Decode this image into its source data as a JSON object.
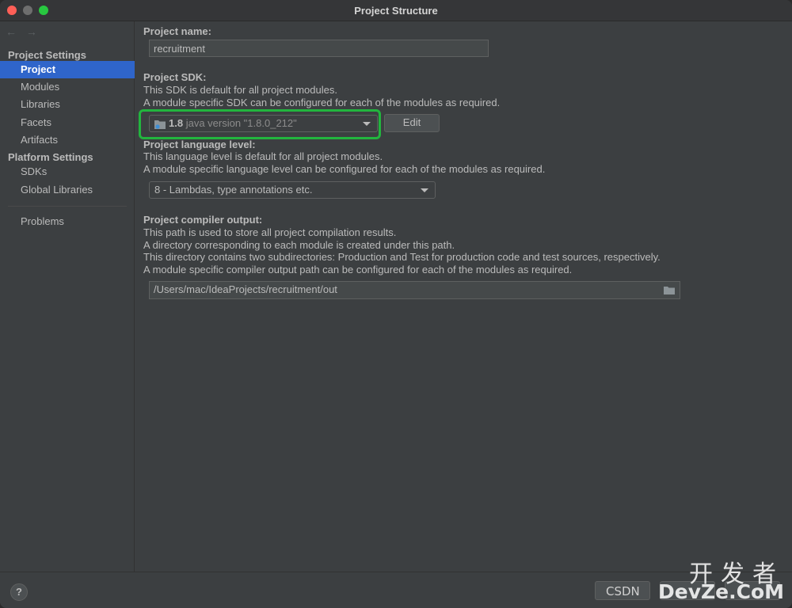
{
  "window": {
    "title": "Project Structure"
  },
  "sidebar": {
    "back_arrow": "←",
    "forward_arrow": "→",
    "project_settings_header": "Project Settings",
    "project_items": [
      "Project",
      "Modules",
      "Libraries",
      "Facets",
      "Artifacts"
    ],
    "selected": "Project",
    "platform_settings_header": "Platform Settings",
    "platform_items": [
      "SDKs",
      "Global Libraries"
    ],
    "problems": "Problems"
  },
  "main": {
    "name_label": "Project name:",
    "name_value": "recruitment",
    "sdk_label": "Project SDK:",
    "sdk_desc_1": "This SDK is default for all project modules.",
    "sdk_desc_2": "A module specific SDK can be configured for each of the modules as required.",
    "sdk_num": "1.8",
    "sdk_version": "java version \"1.8.0_212\"",
    "edit_button": "Edit",
    "lang_label": "Project language level:",
    "lang_desc_1": "This language level is default for all project modules.",
    "lang_desc_2": "A module specific language level can be configured for each of the modules as required.",
    "lang_value": "8 - Lambdas, type annotations etc.",
    "output_label": "Project compiler output:",
    "output_desc_1": "This path is used to store all project compilation results.",
    "output_desc_2": "A directory corresponding to each module is created under this path.",
    "output_desc_3": "This directory contains two subdirectories: Production and Test for production code and test sources, respectively.",
    "output_desc_4": "A module specific compiler output path can be configured for each of the modules as required.",
    "output_value": "/Users/mac/IdeaProjects/recruitment/out"
  },
  "bottom": {
    "help": "?"
  },
  "watermark": {
    "csdn": "CSDN",
    "cn": "开发者",
    "en": "DevZe.CoM"
  },
  "colors": {
    "selection": "#2f65ca",
    "highlight": "#22b53e",
    "panel": "#3c3f41"
  }
}
